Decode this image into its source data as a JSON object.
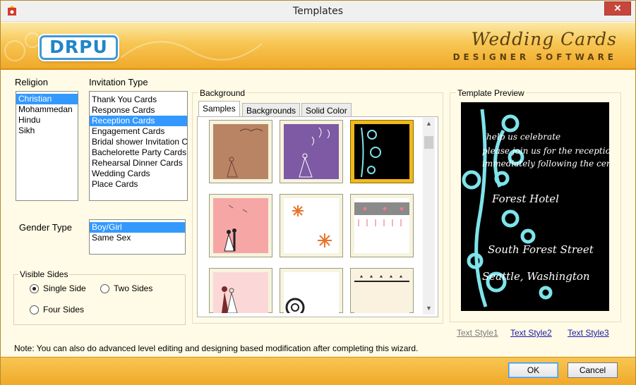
{
  "window": {
    "title": "Templates",
    "close_glyph": "✕"
  },
  "banner": {
    "logo": "DRPU",
    "brand_title": "Wedding Cards",
    "brand_subtitle": "DESIGNER SOFTWARE"
  },
  "religion": {
    "label": "Religion",
    "items": [
      "Christian",
      "Mohammedan",
      "Hindu",
      "Sikh"
    ],
    "selected": "Christian"
  },
  "invitation": {
    "label": "Invitation Type",
    "items": [
      "Thank You Cards",
      "Response Cards",
      "Reception Cards",
      "Engagement Cards",
      "Bridal shower Invitation C",
      "Bachelorette Party Cards",
      "Rehearsal Dinner Cards",
      "Wedding Cards",
      "Place Cards"
    ],
    "selected": "Reception Cards"
  },
  "gender": {
    "label": "Gender Type",
    "items": [
      "Boy/Girl",
      "Same Sex"
    ],
    "selected": "Boy/Girl"
  },
  "visible_sides": {
    "label": "Visible Sides",
    "options": [
      "Single Side",
      "Two Sides",
      "Four Sides"
    ],
    "selected": "Single Side"
  },
  "background": {
    "label": "Background",
    "tabs": [
      "Samples",
      "Backgrounds",
      "Solid Color"
    ],
    "active_tab": "Samples"
  },
  "preview": {
    "label": "Template Preview",
    "lines": [
      "help us celebrate",
      "please join us for the reception",
      "immediately following the ceremony",
      "Forest Hotel",
      "South Forest Street",
      "Seattle, Washington"
    ]
  },
  "text_styles": [
    "Text Style1",
    "Text Style2",
    "Text Style3"
  ],
  "note": "Note: You can also do advanced level editing and designing based modification after completing this wizard.",
  "buttons": {
    "ok": "OK",
    "cancel": "Cancel"
  },
  "colors": {
    "accent": "#f0a92a",
    "selection": "#3399ff",
    "preview_flower": "#7fe3ea"
  }
}
